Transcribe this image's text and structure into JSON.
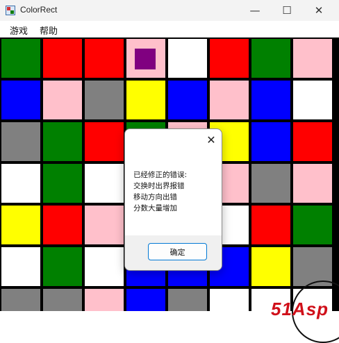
{
  "window": {
    "title": "ColorRect",
    "minimize_glyph": "—",
    "maximize_glyph": "☐",
    "close_glyph": "✕"
  },
  "menu": [
    {
      "label": "游戏"
    },
    {
      "label": "帮助"
    }
  ],
  "colors": {
    "G": "#008000",
    "R": "#ff0000",
    "P": "#ffc0cb",
    "W": "#ffffff",
    "B": "#0000ff",
    "A": "#808080",
    "Y": "#ffff00",
    "grid": "#000000",
    "marker": "#800080"
  },
  "board": {
    "rows": [
      [
        "G",
        "R",
        "R",
        "P",
        "W",
        "R",
        "G",
        "P"
      ],
      [
        "B",
        "P",
        "A",
        "Y",
        "B",
        "P",
        "B",
        "W"
      ],
      [
        "A",
        "G",
        "R",
        "G",
        "P",
        "Y",
        "B",
        "R"
      ],
      [
        "W",
        "G",
        "W",
        "W",
        "P",
        "P",
        "A",
        "P"
      ],
      [
        "Y",
        "R",
        "P",
        "G",
        "W",
        "W",
        "R",
        "G"
      ],
      [
        "W",
        "G",
        "W",
        "B",
        "B",
        "B",
        "Y",
        "A"
      ],
      [
        "A",
        "A",
        "P",
        "B",
        "A",
        "W",
        "W",
        "W"
      ]
    ],
    "marker_cell": "row 1, column 4"
  },
  "dialog": {
    "close_glyph": "✕",
    "lines": [
      "已经修正的错误:",
      "交换时出界报错",
      "移动方向出错",
      "分数大量增加"
    ],
    "ok_label": "确定"
  },
  "watermark": {
    "text": "51Asp"
  }
}
